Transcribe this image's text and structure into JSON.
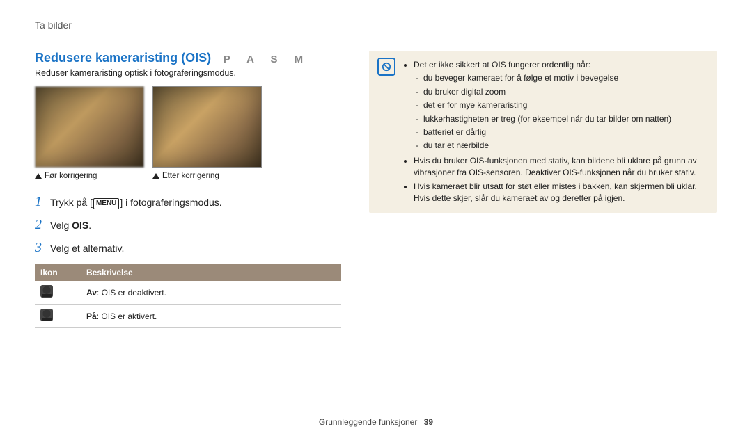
{
  "breadcrumb": "Ta bilder",
  "headline": "Redusere kameraristing (OIS)",
  "mode_letters": "P A S M",
  "subtext": "Reduser kameraristing optisk i fotograferingsmodus.",
  "captions": {
    "before": "Før korrigering",
    "after": "Etter korrigering"
  },
  "steps": {
    "s1_a": "Trykk på [",
    "s1_menu": "MENU",
    "s1_b": "] i fotograferingsmodus.",
    "s2_a": "Velg ",
    "s2_b": "OIS",
    "s2_c": ".",
    "s3": "Velg et alternativ."
  },
  "table": {
    "head_icon": "Ikon",
    "head_desc": "Beskrivelse",
    "rows": [
      {
        "label": "Av",
        "desc": ": OIS er deaktivert."
      },
      {
        "label": "På",
        "desc": ": OIS er aktivert."
      }
    ]
  },
  "note": {
    "lead": "Det er ikke sikkert at OIS fungerer ordentlig når:",
    "sub": [
      "du beveger kameraet for å følge et motiv i bevegelse",
      "du bruker digital zoom",
      "det er for mye kameraristing",
      "lukkerhastigheten er treg (for eksempel når du tar bilder om natten)",
      "batteriet er dårlig",
      "du tar et nærbilde"
    ],
    "b2": "Hvis du bruker OIS-funksjonen med stativ, kan bildene bli uklare på grunn av vibrasjoner fra OIS-sensoren. Deaktiver OIS-funksjonen når du bruker stativ.",
    "b3": "Hvis kameraet blir utsatt for støt eller mistes i bakken, kan skjermen bli uklar. Hvis dette skjer, slår du kameraet av og deretter på igjen."
  },
  "footer": {
    "section": "Grunnleggende funksjoner",
    "page": "39"
  }
}
